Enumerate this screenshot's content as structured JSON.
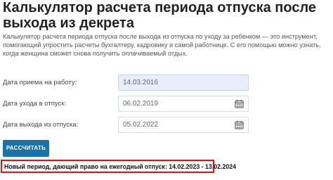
{
  "header": {
    "title": "Калькулятор расчета периода отпуска после выхода из декрета"
  },
  "description": "Калькулятор расчета периода отпуска после выхода из отпуска по уходу за ребенком — это инструмент, помогающий упростить расчеты бухгалтеру, кадровику и самой работнице. С его помощью можно узнать, когда женщина сможет снова получить оплачиваемый отдых.",
  "form": {
    "hire_date": {
      "label": "Дата приема на работу:",
      "value": "14.03.2016"
    },
    "leave_date": {
      "label": "Дата ухода в отпуск:",
      "value": "06.02.2019"
    },
    "return_date": {
      "label": "Дата выхода из отпуска:",
      "value": "05.02.2022"
    },
    "calc_button": "РАССЧИТАТЬ"
  },
  "result": "Новый период, дающий право на ежегодный отпуск: 14.02.2023 - 13.02.2024",
  "colors": {
    "button": "#1a73a8",
    "result_border": "#d3151b",
    "active_field": "#e9eefc"
  },
  "icons": {
    "calendar": "calendar-icon"
  }
}
